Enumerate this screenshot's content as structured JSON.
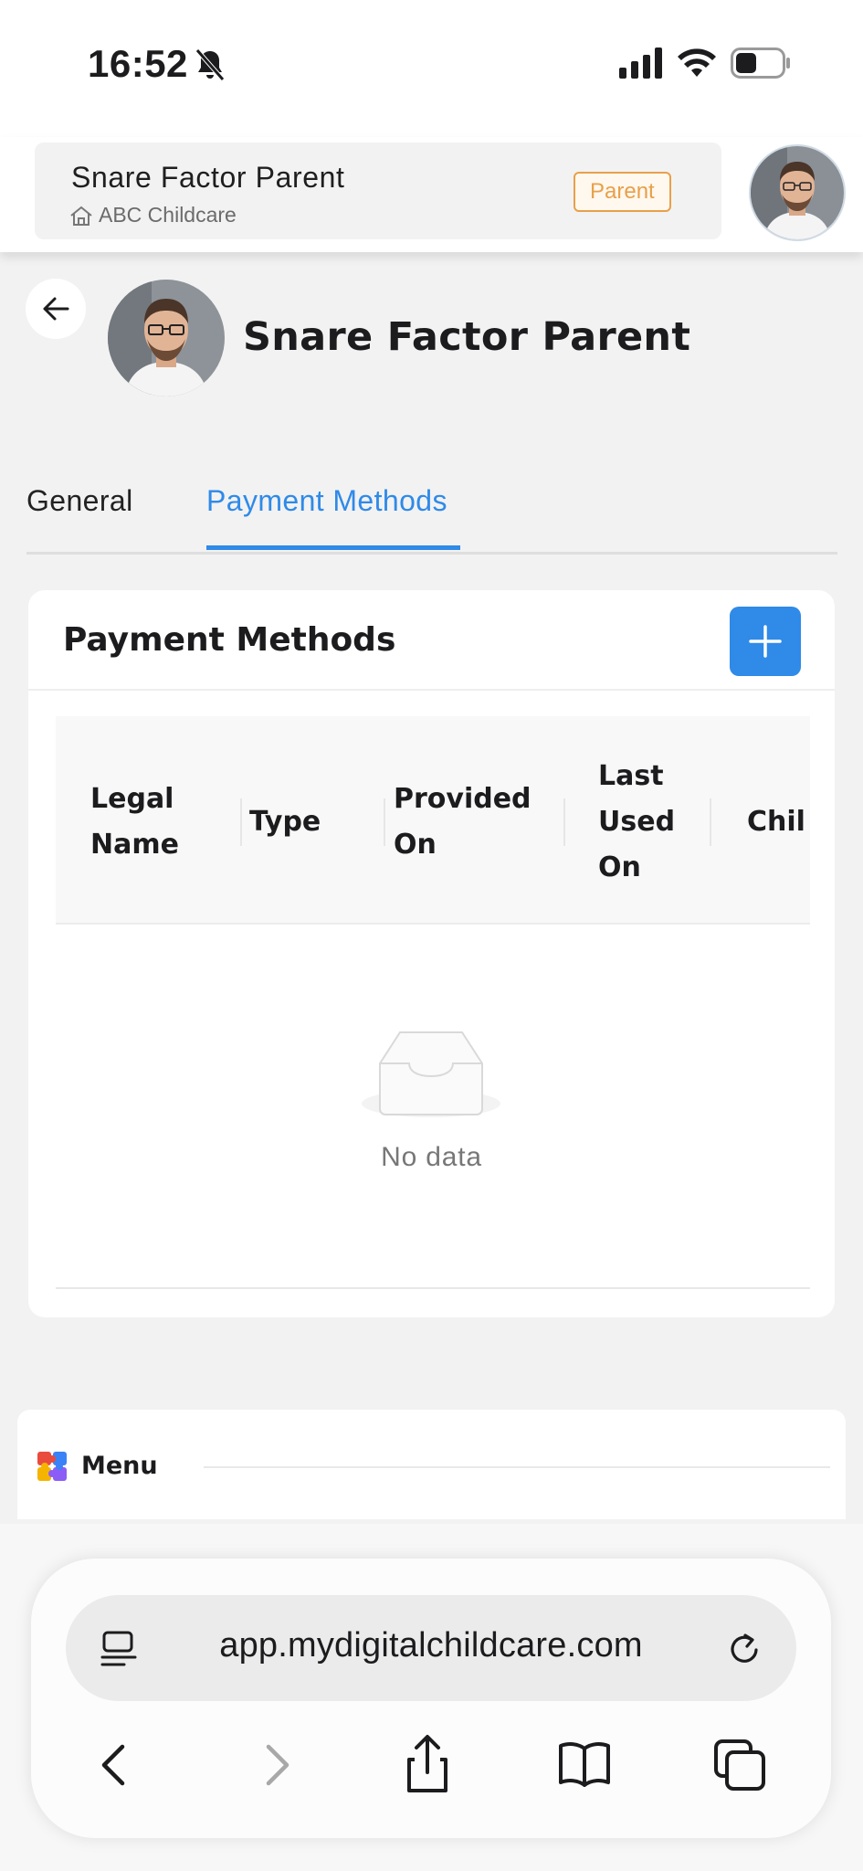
{
  "status_bar": {
    "time": "16:52",
    "silent_icon": "bell-slash-icon",
    "signal_icon": "cellular-signal-icon",
    "wifi_icon": "wifi-icon",
    "battery_icon": "battery-icon"
  },
  "header": {
    "user_name": "Snare Factor Parent",
    "school_icon": "home-icon",
    "school": "ABC Childcare",
    "role": "Parent",
    "role_color": "#e8a04a"
  },
  "profile": {
    "back_icon": "arrow-left-icon",
    "name": "Snare Factor Parent"
  },
  "tabs": [
    {
      "label": "General",
      "active": false
    },
    {
      "label": "Payment Methods",
      "active": true
    }
  ],
  "accent_color": "#2f8ae8",
  "payment_card": {
    "title": "Payment Methods",
    "add_icon": "plus-icon",
    "columns": [
      {
        "lines": [
          "Legal",
          "Name"
        ]
      },
      {
        "lines": [
          "Type"
        ]
      },
      {
        "lines": [
          "Provided",
          "On"
        ]
      },
      {
        "lines": [
          "Last",
          "Used",
          "On"
        ]
      },
      {
        "lines": [
          "Chil"
        ]
      }
    ],
    "empty_icon": "empty-inbox-icon",
    "empty_text": "No data"
  },
  "menu": {
    "icon": "puzzle-icon",
    "label": "Menu"
  },
  "browser": {
    "url": "app.mydigitalchildcare.com",
    "page_icon": "page-menu-icon",
    "reload_icon": "reload-icon",
    "nav": [
      "back-icon",
      "forward-icon",
      "share-icon",
      "bookmarks-icon",
      "tabs-icon"
    ]
  }
}
